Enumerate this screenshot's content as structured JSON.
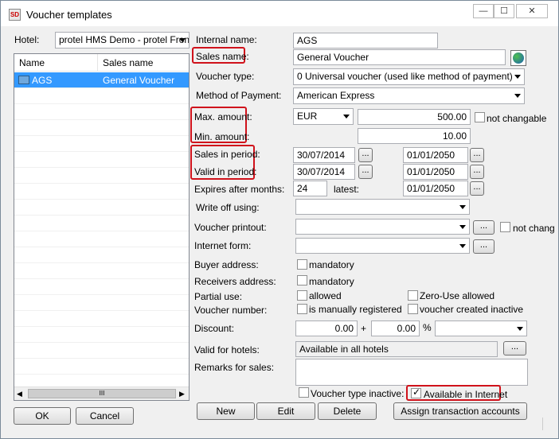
{
  "window": {
    "title": "Voucher templates",
    "app_icon": "SD",
    "controls": [
      "—",
      "☐",
      "✕"
    ]
  },
  "hotel": {
    "label": "Hotel:",
    "value": "protel HMS Demo - protel Front"
  },
  "list": {
    "columns": [
      "Name",
      "Sales name"
    ],
    "rows": [
      {
        "name": "AGS",
        "sales_name": "General Voucher"
      }
    ],
    "scroll_thumb": "III"
  },
  "form": {
    "internal_name_label": "Internal name:",
    "internal_name": "AGS",
    "sales_name_label": "Sales name:",
    "sales_name": "General Voucher",
    "voucher_type_label": "Voucher type:",
    "voucher_type": "0 Universal voucher (used like method of payment)",
    "method_label": "Method of Payment:",
    "method": "American Express",
    "max_label": "Max. amount:",
    "currency": "EUR",
    "max_amount": "500.00",
    "not_changable": "not changable",
    "min_label": "Min. amount:",
    "min_amount": "10.00",
    "sales_period_label": "Sales in period:",
    "sales_from": "30/07/2014",
    "sales_to": "01/01/2050",
    "valid_period_label": "Valid in period:",
    "valid_from": "30/07/2014",
    "valid_to": "01/01/2050",
    "expires_label": "Expires after months:",
    "expires_months": "24",
    "latest_label": "latest:",
    "latest": "01/01/2050",
    "write_off_label": "Write off using:",
    "printout_label": "Voucher printout:",
    "not_changable2": "not changa",
    "internet_form_label": "Internet form:",
    "buyer_label": "Buyer address:",
    "mandatory": "mandatory",
    "receivers_label": "Receivers address:",
    "partial_label": "Partial use:",
    "allowed": "allowed",
    "zero_use": "Zero-Use allowed",
    "number_label": "Voucher number:",
    "manually": "is manually registered",
    "created_inactive": "voucher created inactive",
    "discount_label": "Discount:",
    "discount1": "0.00",
    "plus": "+",
    "discount2": "0.00",
    "percent": "%",
    "hotels_label": "Valid for hotels:",
    "hotels": "Available in all hotels",
    "remarks_label": "Remarks for sales:",
    "type_inactive": "Voucher type inactive:",
    "available_internet": "Available in Internet",
    "dots": "..."
  },
  "buttons": {
    "new": "New",
    "edit": "Edit",
    "delete": "Delete",
    "assign": "Assign transaction accounts",
    "ok": "OK",
    "cancel": "Cancel"
  }
}
